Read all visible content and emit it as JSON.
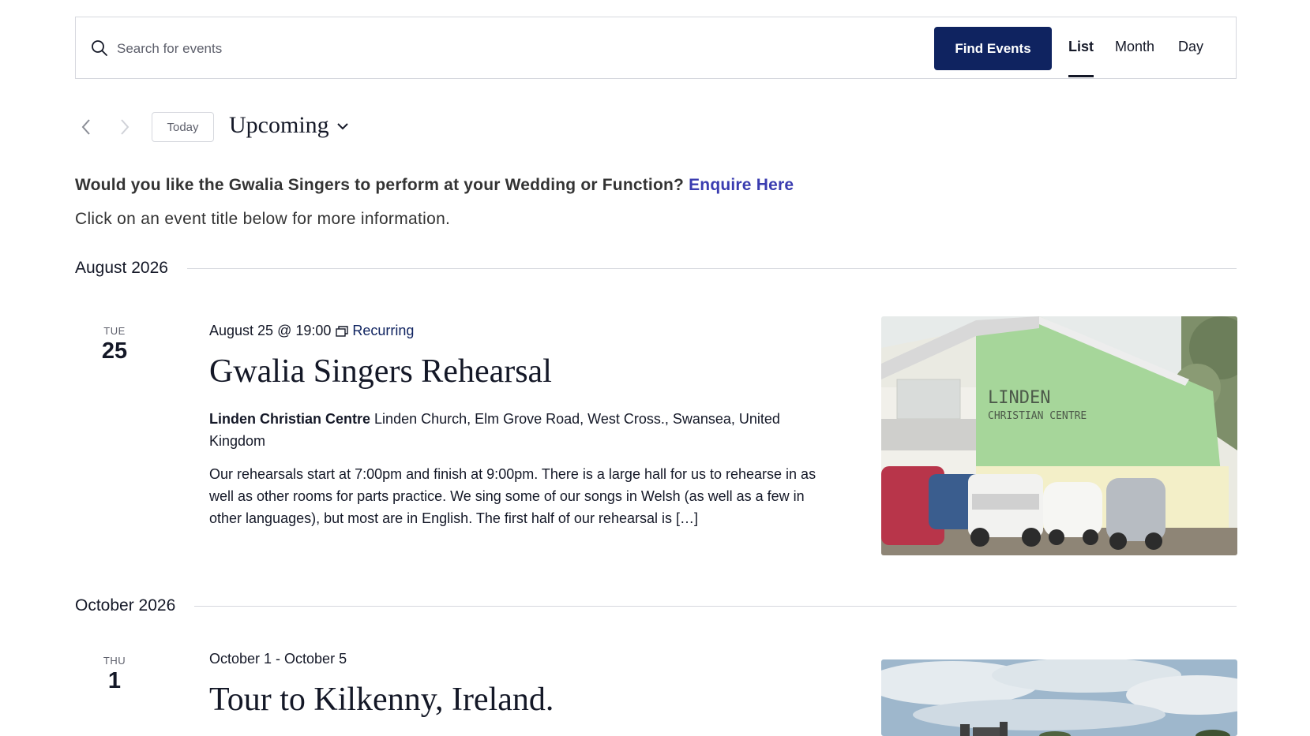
{
  "search": {
    "placeholder": "Search for events",
    "button_label": "Find Events"
  },
  "views": {
    "list": "List",
    "month": "Month",
    "day": "Day",
    "active": "List"
  },
  "nav": {
    "today_label": "Today",
    "range_label": "Upcoming"
  },
  "intro": {
    "question": "Would you like the Gwalia Singers to perform at your Wedding or Function?",
    "enquire_link": "Enquire Here",
    "instruction": "Click on an event title below for more information."
  },
  "months": [
    {
      "label": "August 2026",
      "events": [
        {
          "dow": "TUE",
          "day": "25",
          "datetime": "August 25 @ 19:00",
          "recurring_label": "Recurring",
          "title": "Gwalia Singers Rehearsal",
          "venue_name": "Linden Christian Centre",
          "venue_address": "Linden Church, Elm Grove Road, West Cross., Swansea, United Kingdom",
          "description": "Our rehearsals start at 7:00pm and finish at 9:00pm. There is a large hall for us to rehearse in as well as other rooms for parts practice. We sing some of our songs in Welsh (as well as a few in other languages), but most are in English.  The first half of our rehearsal is […]",
          "image_sign_line1": "LINDEN",
          "image_sign_line2": "CHRISTIAN CENTRE"
        }
      ]
    },
    {
      "label": "October 2026",
      "events": [
        {
          "dow": "THU",
          "day": "1",
          "datetime": "October 1 - October 5",
          "title": "Tour to Kilkenny, Ireland."
        }
      ]
    }
  ],
  "colors": {
    "primary": "#0f2360",
    "link": "#3a3cb0",
    "border": "#d6d8de",
    "text": "#141827"
  }
}
